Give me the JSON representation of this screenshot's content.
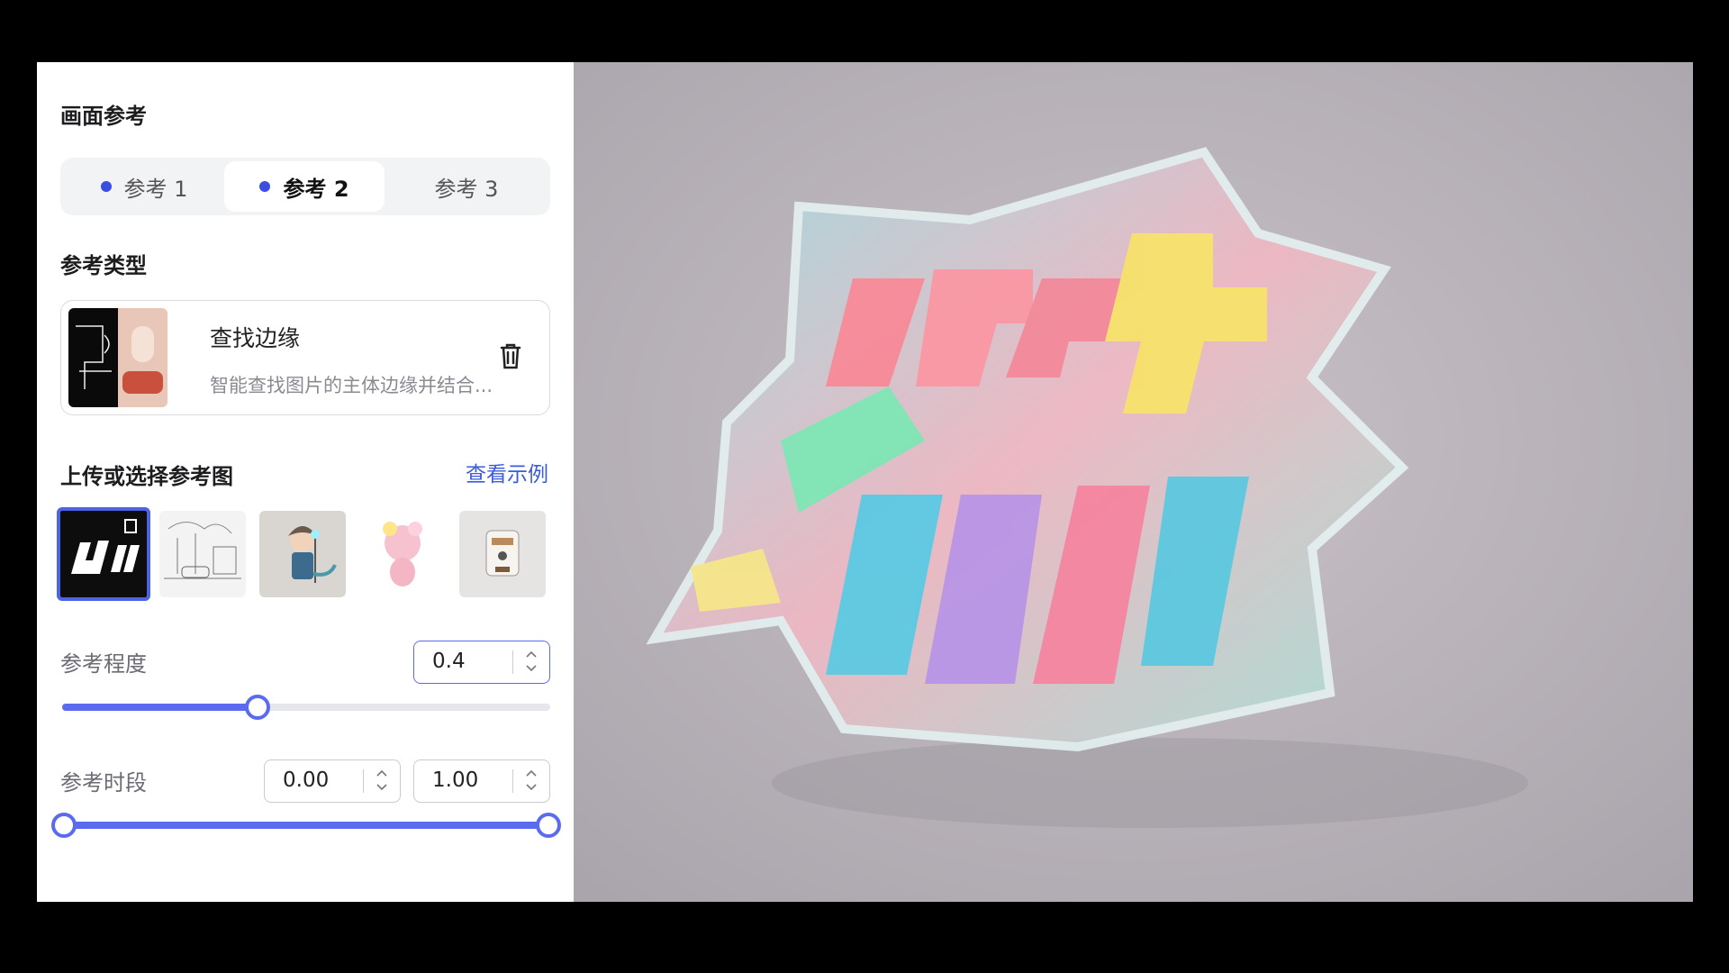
{
  "panel": {
    "section1_title": "画面参考",
    "tabs": [
      {
        "label": "参考 1",
        "has_dot": true,
        "active": false
      },
      {
        "label": "参考 2",
        "has_dot": true,
        "active": true
      },
      {
        "label": "参考 3",
        "has_dot": false,
        "active": false
      }
    ],
    "section2_title": "参考类型",
    "type_card": {
      "title": "查找边缘",
      "description": "智能查找图片的主体边缘并结合...",
      "delete_icon": "trash-icon"
    },
    "section3_title": "上传或选择参考图",
    "view_examples_link": "查看示例",
    "reference_images": [
      {
        "name": "graffiti-text-image",
        "selected": true
      },
      {
        "name": "sketch-street-image",
        "selected": false
      },
      {
        "name": "anime-boy-image",
        "selected": false
      },
      {
        "name": "pink-creature-image",
        "selected": false
      },
      {
        "name": "coffee-machine-image",
        "selected": false
      }
    ],
    "strength": {
      "label": "参考程度",
      "value": "0.4",
      "fraction": 0.4
    },
    "time_range": {
      "label": "参考时段",
      "start": "0.00",
      "end": "1.00",
      "start_fraction": 0.0,
      "end_fraction": 1.0
    }
  },
  "colors": {
    "accent": "#5b6bf0",
    "link": "#3b5bdb",
    "tab_bg": "#f2f3f5"
  }
}
